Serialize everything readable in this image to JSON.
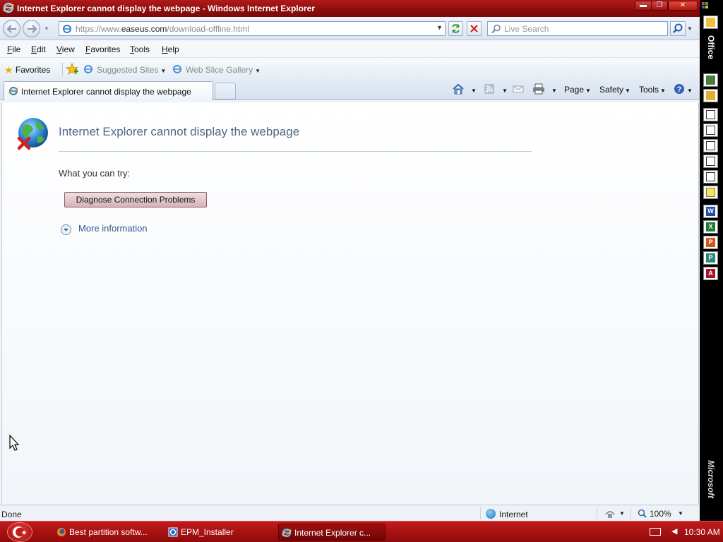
{
  "window": {
    "title": "Internet Explorer cannot display the webpage - Windows Internet Explorer",
    "min_glyph": "▬",
    "max_glyph": "❐",
    "close_glyph": "✕"
  },
  "address": {
    "url_prefix": "https://www.",
    "url_host": "easeus.com",
    "url_path": "/download-offline.html",
    "search_placeholder": "Live Search"
  },
  "menu": {
    "items": [
      "File",
      "Edit",
      "View",
      "Favorites",
      "Tools",
      "Help"
    ]
  },
  "favorites_bar": {
    "favorites_label": "Favorites",
    "suggested_sites": "Suggested Sites",
    "web_slice_gallery": "Web Slice Gallery"
  },
  "tabs": {
    "active_label": "Internet Explorer cannot display the webpage"
  },
  "command_bar": {
    "page": "Page",
    "safety": "Safety",
    "tools": "Tools"
  },
  "page": {
    "heading": "Internet Explorer cannot display the webpage",
    "try_label": "What you can try:",
    "diagnose_button": "Diagnose Connection Problems",
    "more_info": "More information"
  },
  "status": {
    "text": "Done",
    "zone": "Internet",
    "zoom": "100%"
  },
  "office_bar": {
    "label": "Office",
    "brand": "Microsoft",
    "icons": [
      "office-folder-icon",
      "new-office-document-icon",
      "open-office-document-icon",
      "new-message-icon",
      "new-appointment-icon",
      "new-task-icon",
      "new-contact-icon",
      "new-journal-entry-icon",
      "new-note-icon",
      "microsoft-word-icon",
      "microsoft-excel-icon",
      "microsoft-powerpoint-icon",
      "microsoft-publisher-icon",
      "microsoft-access-icon"
    ]
  },
  "taskbar": {
    "tasks": [
      "Best partition softw...",
      "EPM_Installer",
      "Internet Explorer c..."
    ],
    "clock": "10:30 AM"
  },
  "colors": {
    "title_bar": "#8c0c0c",
    "taskbar": "#b31515",
    "heading": "#4e6785",
    "link": "#2a5a8c"
  }
}
